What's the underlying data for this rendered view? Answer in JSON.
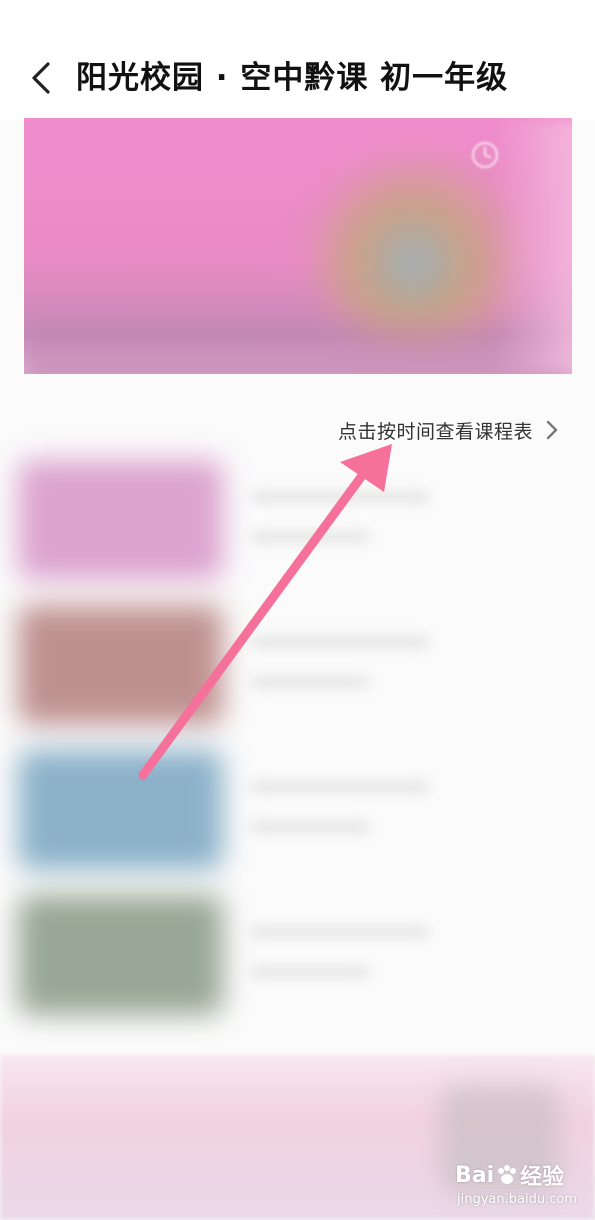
{
  "header": {
    "title": "阳光校园 · 空中黔课 初一年级",
    "back_icon": "chevron-left-icon"
  },
  "banner": {
    "icon": "clock-icon"
  },
  "schedule": {
    "link_text": "点击按时间查看课程表",
    "icon": "chevron-right-icon"
  },
  "courses": [
    {
      "thumb_color": "#d99acb"
    },
    {
      "thumb_color": "#b88684"
    },
    {
      "thumb_color": "#7fa9c4"
    },
    {
      "thumb_color": "#8e9e8a"
    }
  ],
  "annotation": {
    "color": "#f5709b"
  },
  "watermark": {
    "brand_left": "Bai",
    "brand_right": "经验",
    "url": "jingyan.baidu.com"
  }
}
